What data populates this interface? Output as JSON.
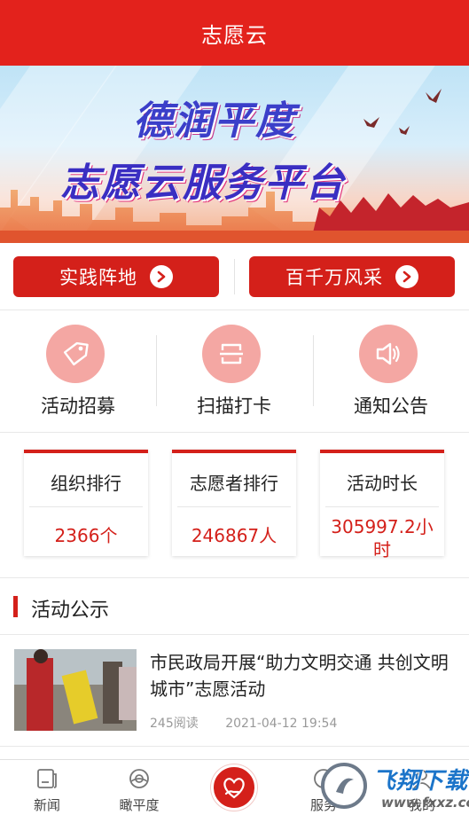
{
  "header": {
    "title": "志愿云"
  },
  "banner": {
    "line1": "德润平度",
    "line2": "志愿云服务平台"
  },
  "buttons": [
    {
      "label": "实践阵地"
    },
    {
      "label": "百千万风采"
    }
  ],
  "features": [
    {
      "label": "活动招募",
      "icon": "tag-icon"
    },
    {
      "label": "扫描打卡",
      "icon": "scan-icon"
    },
    {
      "label": "通知公告",
      "icon": "speaker-icon"
    }
  ],
  "stats": [
    {
      "title": "组织排行",
      "value": "2366个"
    },
    {
      "title": "志愿者排行",
      "value": "246867人"
    },
    {
      "title": "活动时长",
      "value": "305997.2小时"
    }
  ],
  "section": {
    "title": "活动公示"
  },
  "news": [
    {
      "title": "市民政局开展“助力文明交通 共创文明城市”志愿活动",
      "reads": "245阅读",
      "time": "2021-04-12 19:54"
    }
  ],
  "tabbar": [
    {
      "label": "新闻",
      "icon": "news-icon"
    },
    {
      "label": "瞰平度",
      "icon": "compass-icon"
    },
    {
      "label": "",
      "icon": "heart-hand-icon"
    },
    {
      "label": "服务",
      "icon": "service-icon"
    },
    {
      "label": "我的",
      "icon": "user-icon"
    }
  ],
  "watermark": {
    "text": "飞翔下载",
    "sub": "www.fxxz.com"
  },
  "colors": {
    "brand": "#e3221c",
    "button": "#d4201a",
    "icon_bg": "#f4a7a3"
  }
}
